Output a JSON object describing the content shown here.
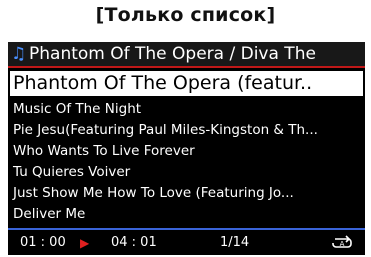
{
  "caption": "[Только список]",
  "header": {
    "title": "Phantom Of The Opera / Diva The",
    "icon": "music-note-icon"
  },
  "list": {
    "selected": "Phantom Of The Opera (featur..",
    "items": [
      "Music Of The Night",
      "Pie Jesu(Featuring Paul Miles-Kingston & Th...",
      "Who Wants To Live Forever",
      "Tu Quieres Voiver",
      "Just Show Me How To Love (Featuring Jo...",
      "Deliver Me"
    ]
  },
  "footer": {
    "elapsed": "01 : 00",
    "total": "04 : 01",
    "position": "1/14",
    "play_icon": "play-icon",
    "repeat_icon": "repeat-icon"
  },
  "colors": {
    "accent_red": "#c01818",
    "progress_blue": "#3a64d8",
    "play_red": "#e02020",
    "note_blue": "#4a90ff"
  }
}
